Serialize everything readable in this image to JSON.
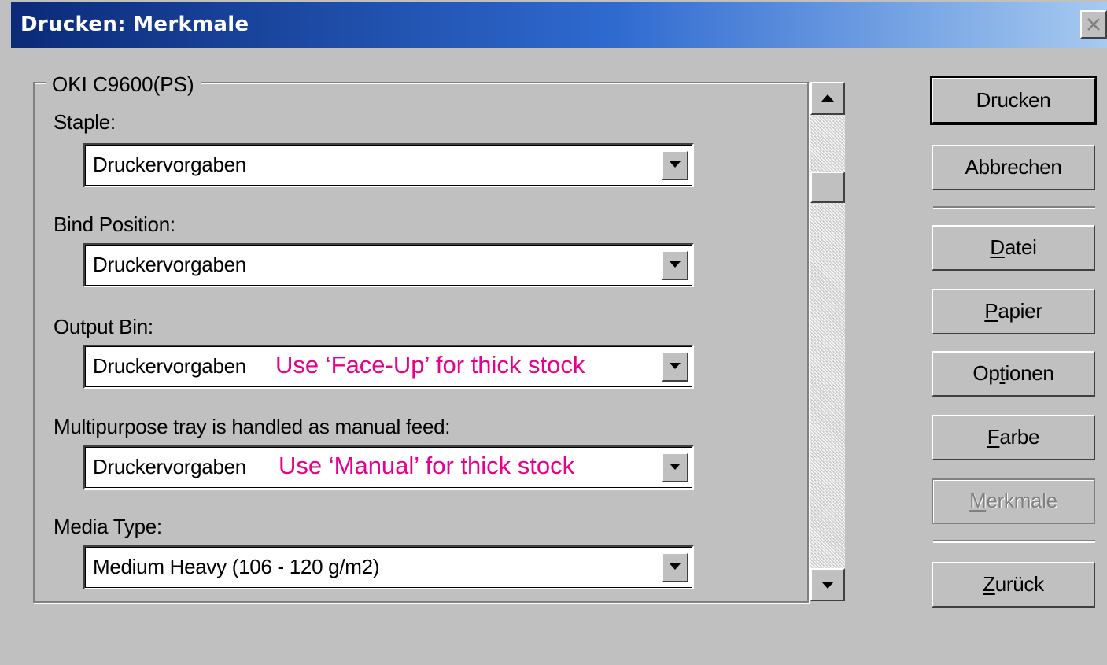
{
  "window": {
    "title": "Drucken: Merkmale"
  },
  "group": {
    "legend": "OKI C9600(PS)",
    "fields": [
      {
        "label": "Staple:",
        "value": "Druckervorgaben",
        "note": ""
      },
      {
        "label": "Bind Position:",
        "value": "Druckervorgaben",
        "note": ""
      },
      {
        "label": "Output Bin:",
        "value": "Druckervorgaben",
        "note": "Use ‘Face-Up’ for thick stock"
      },
      {
        "label": "Multipurpose tray is handled as manual feed:",
        "value": "Druckervorgaben",
        "note": "Use ‘Manual’ for thick stock"
      },
      {
        "label": "Media Type:",
        "value": "Medium Heavy (106 - 120 g/m2)",
        "note": ""
      }
    ]
  },
  "buttons": {
    "drucken": {
      "label": "Drucken"
    },
    "abbrechen": {
      "label": "Abbrechen"
    },
    "datei": {
      "mnemonic": "D",
      "rest": "atei"
    },
    "papier": {
      "mnemonic": "P",
      "rest": "apier"
    },
    "optionen": {
      "pre": "Op",
      "mnemonic": "t",
      "rest": "ionen"
    },
    "farbe": {
      "mnemonic": "F",
      "rest": "arbe"
    },
    "merkmale": {
      "mnemonic": "M",
      "rest": "erkmale"
    },
    "zurueck": {
      "mnemonic": "Z",
      "rest": "urück"
    }
  },
  "colors": {
    "note": "#e8008c",
    "face": "#c0c0c0",
    "title_start": "#0b2a78",
    "title_end": "#a6caf0"
  },
  "icons": {
    "close": "close-icon",
    "dropdown": "chevron-down-icon",
    "scroll_up": "arrow-up-icon",
    "scroll_down": "arrow-down-icon"
  }
}
